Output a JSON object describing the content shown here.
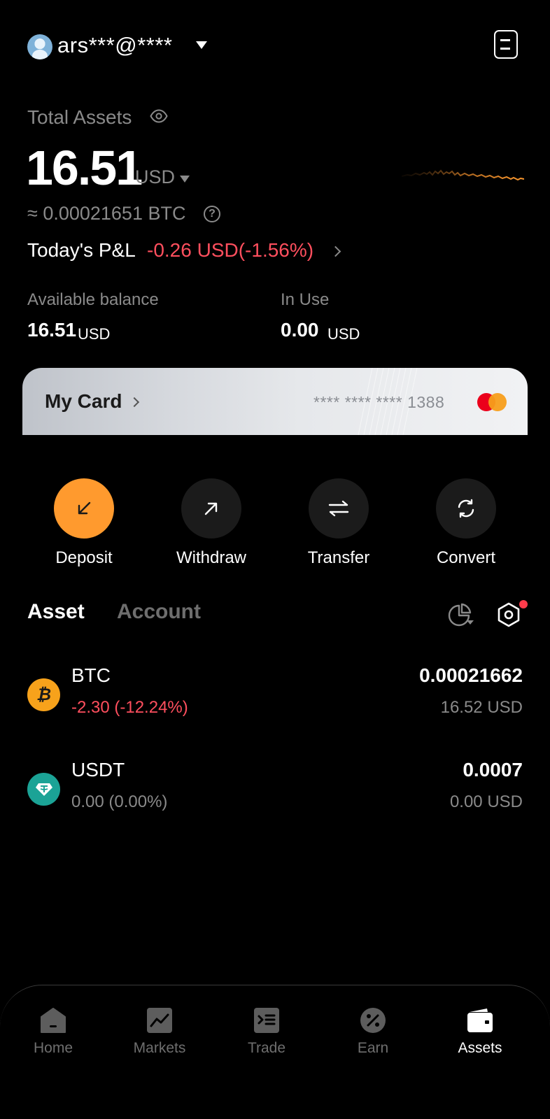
{
  "header": {
    "account_name": "ars***@****"
  },
  "summary": {
    "total_label": "Total Assets",
    "total_amount": "16.51",
    "total_unit": "USD",
    "btc_equivalent": "≈ 0.00021651 BTC",
    "pnl_label": "Today's P&L",
    "pnl_value": "-0.26 USD(-1.56%)",
    "available_label": "Available balance",
    "available_value": "16.51",
    "available_unit": "USD",
    "inuse_label": "In Use",
    "inuse_value": "0.00",
    "inuse_unit": "USD"
  },
  "card": {
    "title": "My Card",
    "number": "**** **** **** 1388"
  },
  "actions": [
    {
      "label": "Deposit"
    },
    {
      "label": "Withdraw"
    },
    {
      "label": "Transfer"
    },
    {
      "label": "Convert"
    }
  ],
  "tabs": {
    "asset": "Asset",
    "account": "Account"
  },
  "assets": [
    {
      "symbol": "BTC",
      "change": "-2.30 (-12.24%)",
      "amount": "0.00021662",
      "usd": "16.52 USD",
      "icon": "bitcoin-icon"
    },
    {
      "symbol": "USDT",
      "change": "0.00 (0.00%)",
      "amount": "0.0007",
      "usd": "0.00 USD",
      "icon": "tether-icon"
    }
  ],
  "nav": [
    {
      "label": "Home",
      "icon": "home-icon"
    },
    {
      "label": "Markets",
      "icon": "markets-icon"
    },
    {
      "label": "Trade",
      "icon": "trade-icon"
    },
    {
      "label": "Earn",
      "icon": "earn-icon"
    },
    {
      "label": "Assets",
      "icon": "wallet-icon"
    }
  ],
  "colors": {
    "accent": "#ff9a2e",
    "negative": "#ff4f5e",
    "muted": "#8a8a8a",
    "background": "#000000"
  }
}
